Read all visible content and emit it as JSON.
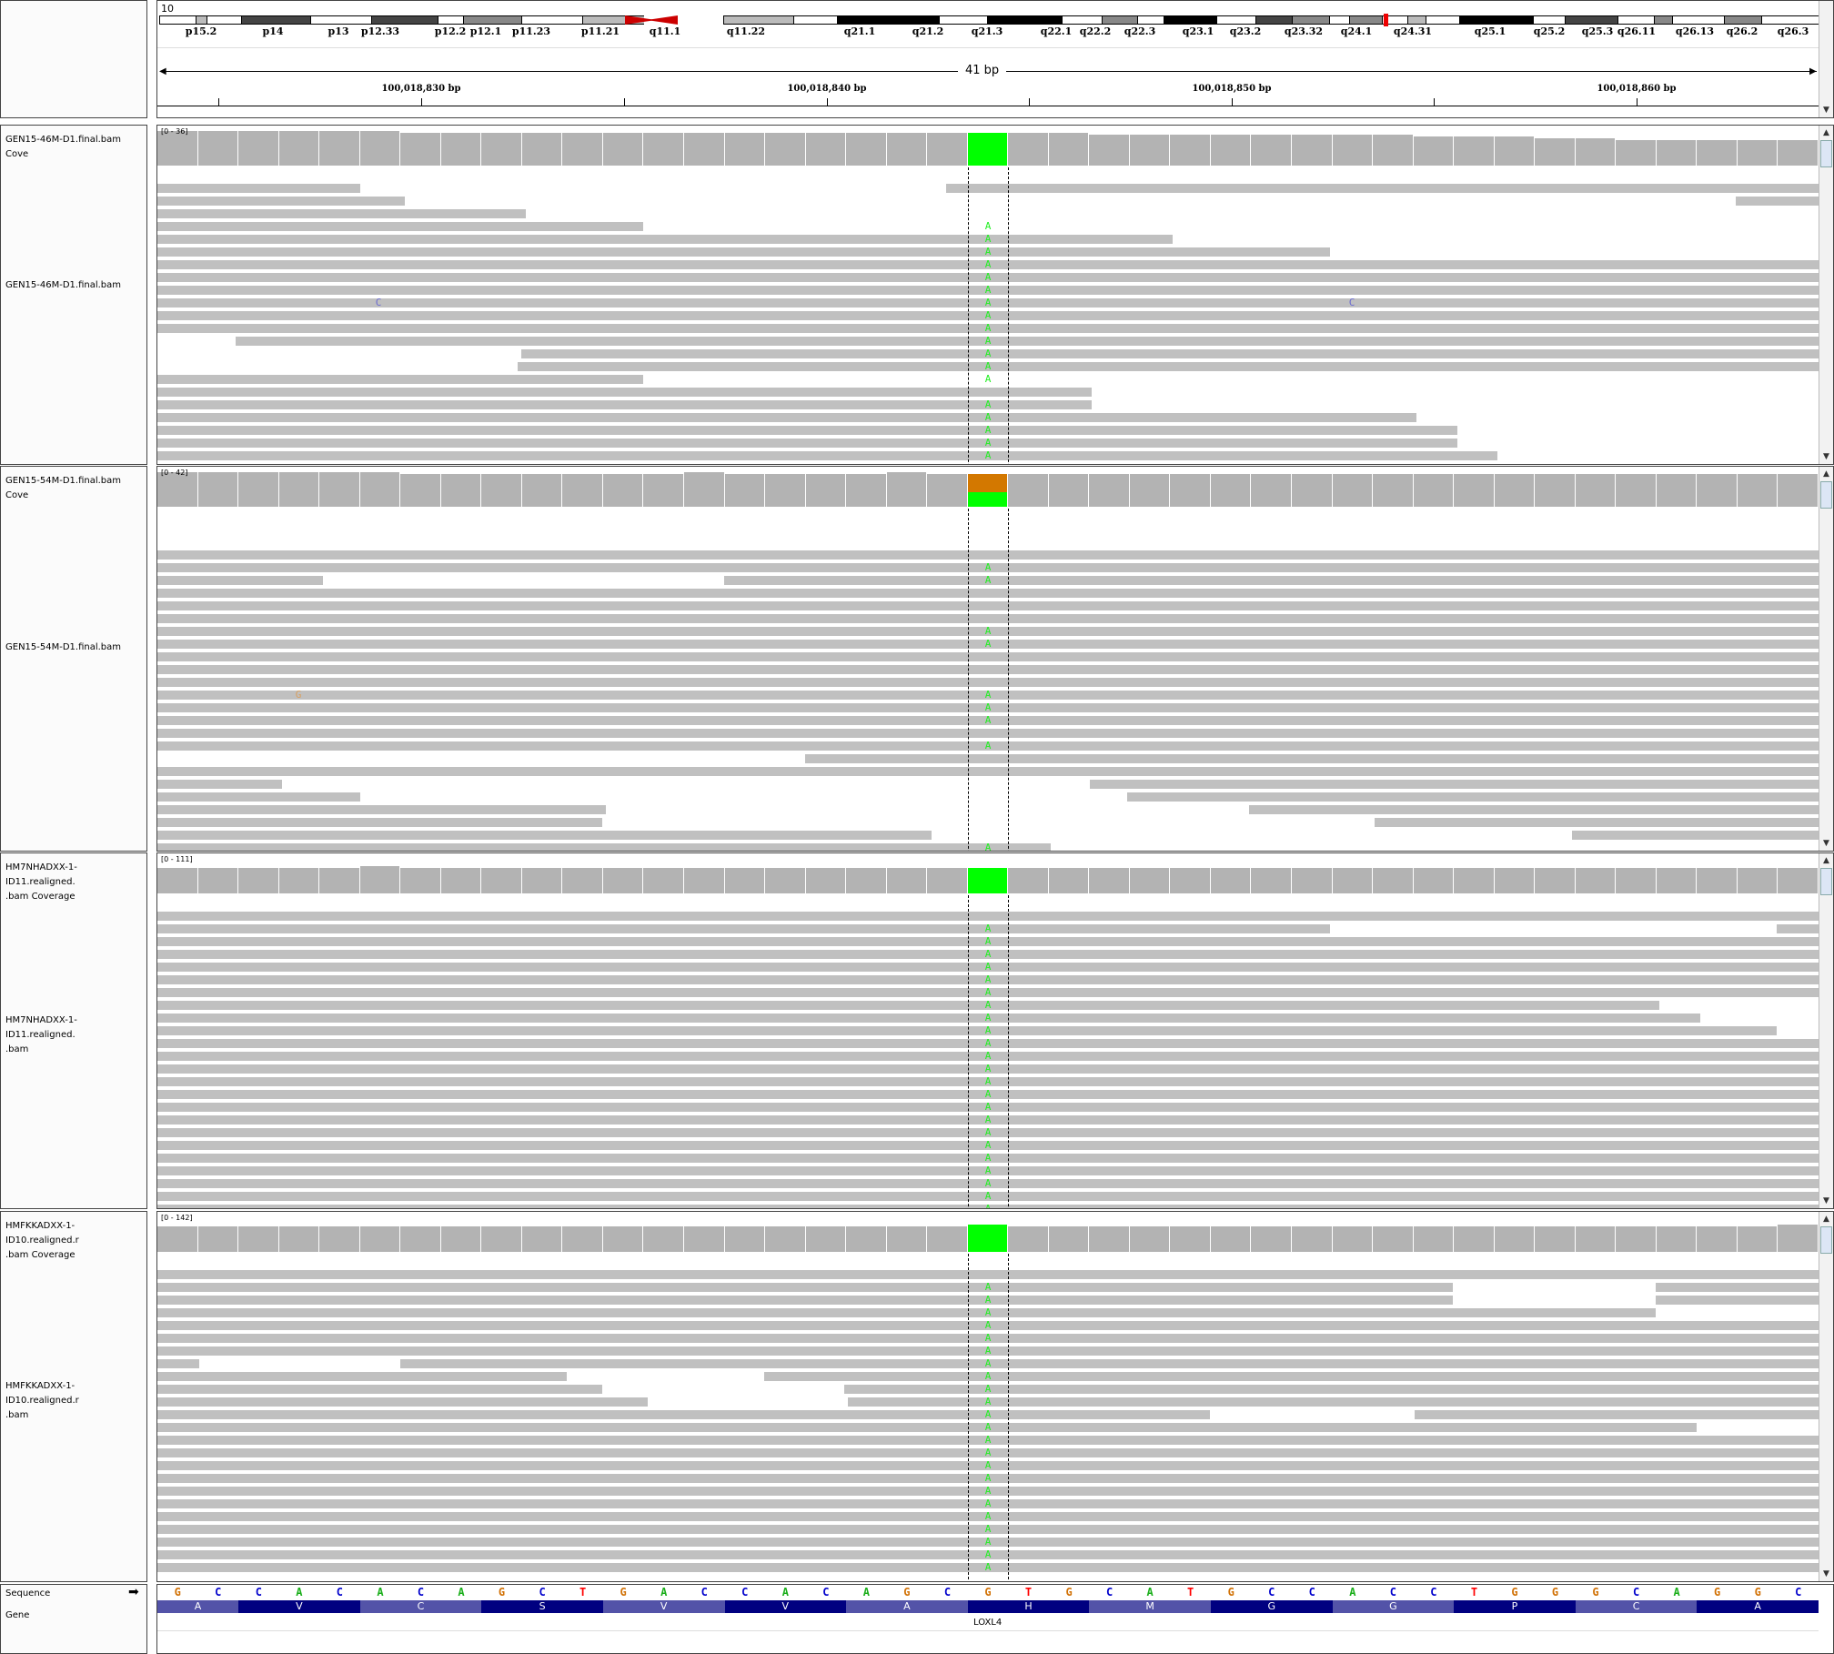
{
  "ideogram": {
    "chromosome": "10",
    "bands": [
      "p15.2",
      "p14",
      "p13",
      "p12.33",
      "p12.2",
      "p12.1",
      "p11.23",
      "p11.21",
      "q11.1",
      "q11.22",
      "q21.1",
      "q21.2",
      "q21.3",
      "q22.1",
      "q22.2",
      "q22.3",
      "q23.1",
      "q23.2",
      "q23.32",
      "q24.1",
      "q24.31",
      "q25.1",
      "q25.2",
      "q25.3",
      "q26.11",
      "q26.13",
      "q26.2",
      "q26.3"
    ]
  },
  "ruler": {
    "span": "41 bp",
    "ticks": [
      "100,018,830 bp",
      "100,018,840 bp",
      "100,018,850 bp",
      "100,018,860 bp"
    ]
  },
  "panels": [
    {
      "coverage_label": "GEN15-46M-D1.final.bam Cove",
      "bam_label": "GEN15-46M-D1.final.bam",
      "range": "[0 - 36]"
    },
    {
      "coverage_label": "GEN15-54M-D1.final.bam Cove",
      "bam_label": "GEN15-54M-D1.final.bam",
      "range": "[0 - 42]"
    },
    {
      "coverage_label": "HM7NHADXX-1-ID11.realigned.\n.bam Coverage",
      "bam_label": "HM7NHADXX-1-ID11.realigned.\n.bam",
      "range": "[0 - 111]"
    },
    {
      "coverage_label": "HMFKKADXX-1-ID10.realigned.r\n.bam Coverage",
      "bam_label": "HMFKKADXX-1-ID10.realigned.r\n.bam",
      "range": "[0 - 142]"
    }
  ],
  "mismatch_base": "A",
  "other_mismatches": {
    "p1a": "C",
    "p1b": "C",
    "p2": "G"
  },
  "sequence_label": "Sequence",
  "sequence_arrow": "➡",
  "gene_label": "Gene",
  "sequence": [
    "G",
    "C",
    "C",
    "A",
    "C",
    "A",
    "C",
    "A",
    "G",
    "C",
    "T",
    "G",
    "A",
    "C",
    "C",
    "A",
    "C",
    "A",
    "G",
    "C",
    "G",
    "T",
    "G",
    "C",
    "A",
    "T",
    "G",
    "C",
    "C",
    "A",
    "C",
    "C",
    "T",
    "G",
    "G",
    "G",
    "C",
    "A",
    "G",
    "G",
    "C"
  ],
  "amino_acids": [
    "A",
    "V",
    "C",
    "S",
    "V",
    "V",
    "A",
    "H",
    "M",
    "G",
    "G",
    "P",
    "C",
    "A"
  ],
  "gene_name": "LOXL4",
  "colors": {
    "read": "#c0c0c0",
    "coverage": "#b3b3b3",
    "snv": "#00ff00",
    "snv_ref_part": "#d37800",
    "base_A": "#1aae1a",
    "base_C": "#0000cc",
    "base_G": "#d17105",
    "base_T": "#ff0000",
    "gene_dark": "#000080",
    "gene_light": "#5353a8"
  }
}
